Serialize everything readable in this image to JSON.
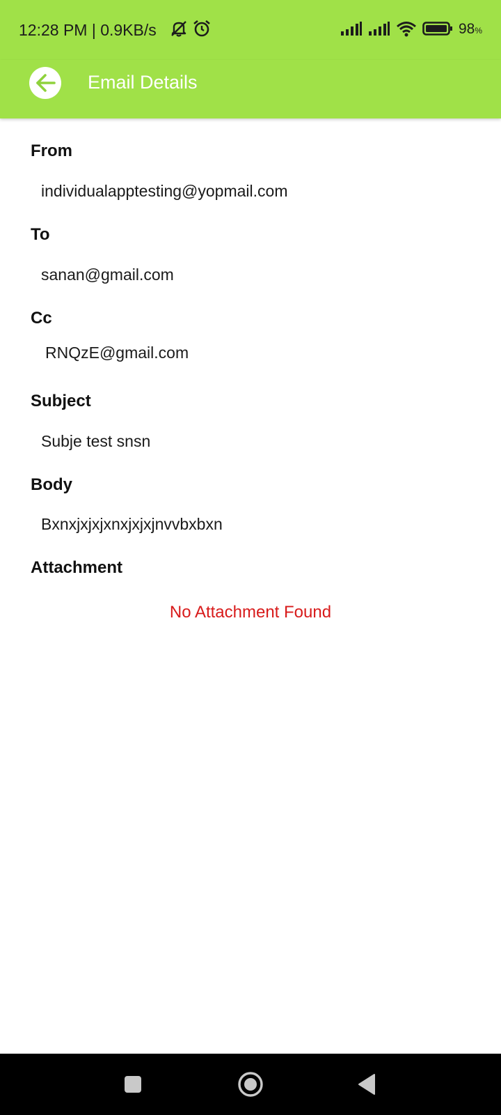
{
  "status_bar": {
    "time_speed": "12:28 PM | 0.9KB/s",
    "battery_percent": "98",
    "battery_unit": "%",
    "icons": [
      "mute-bell-icon",
      "alarm-icon",
      "signal-icon",
      "signal-icon",
      "wifi-icon",
      "battery-icon"
    ]
  },
  "app_bar": {
    "title": "Email Details",
    "background": "#a0e148",
    "back_icon": "arrow-left-icon"
  },
  "fields": {
    "from_label": "From",
    "from_value": "individualapptesting@yopmail.com",
    "to_label": "To",
    "to_value": "sanan@gmail.com",
    "cc_label": "Cc",
    "cc_value": "RNQzE@gmail.com",
    "subject_label": "Subject",
    "subject_value": "Subje test snsn",
    "body_label": "Body",
    "body_value": "Bxnxjxjxjxnxjxjxjnvvbxbxn",
    "attachment_label": "Attachment",
    "attachment_empty": "No Attachment Found",
    "empty_color": "#d81b1b"
  },
  "nav_bar": {
    "recents_icon": "square-icon",
    "home_icon": "circle-icon",
    "back_icon": "triangle-back-icon"
  }
}
